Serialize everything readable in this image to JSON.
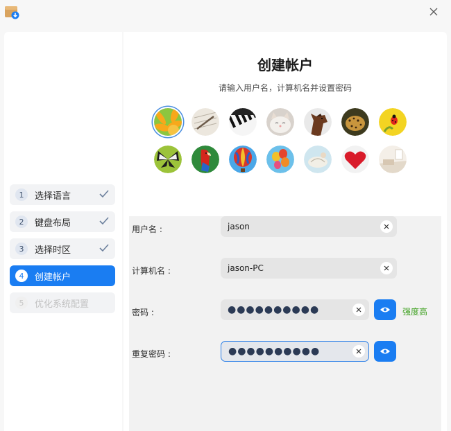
{
  "sidebar": {
    "steps": [
      {
        "num": "1",
        "label": "选择语言",
        "state": "done"
      },
      {
        "num": "2",
        "label": "键盘布局",
        "state": "done"
      },
      {
        "num": "3",
        "label": "选择时区",
        "state": "done"
      },
      {
        "num": "4",
        "label": "创建帐户",
        "state": "active"
      },
      {
        "num": "5",
        "label": "优化系统配置",
        "state": "disabled"
      }
    ]
  },
  "main": {
    "title": "创建帐户",
    "subtitle": "请输入用户名，计算机名并设置密码",
    "avatars": [
      "sunflower",
      "notebook-pen",
      "piano-keys",
      "kitten",
      "horse",
      "leopard",
      "ladybug",
      "butterfly",
      "parrot",
      "hot-air-balloon",
      "balloons",
      "seashell",
      "red-heart",
      "room-interior"
    ],
    "selected_avatar": 0
  },
  "form": {
    "username_label": "用户名 :",
    "username_value": "jason",
    "hostname_label": "计算机名 :",
    "hostname_value": "jason-PC",
    "password_label": "密码 :",
    "password_mask": "●●●●●●●●●●",
    "password_strength": "强度高",
    "repeat_label": "重复密码 :",
    "repeat_mask": "●●●●●●●●●●"
  },
  "colors": {
    "accent": "#1a7df2",
    "strength": "#3da01f"
  }
}
